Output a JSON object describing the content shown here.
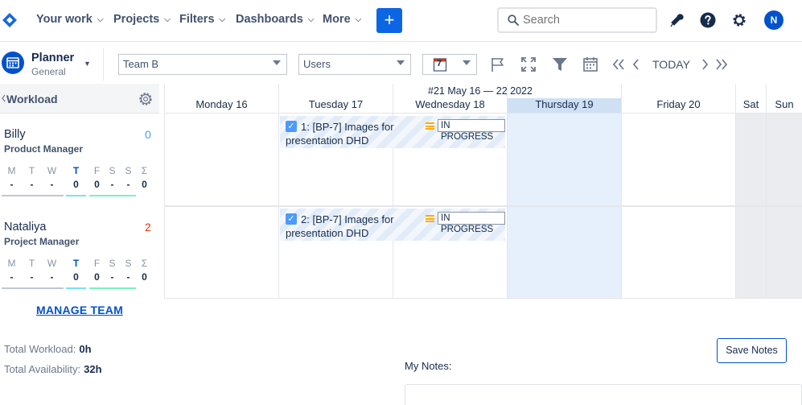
{
  "nav": {
    "items": [
      {
        "label": "Your work"
      },
      {
        "label": "Projects"
      },
      {
        "label": "Filters"
      },
      {
        "label": "Dashboards"
      },
      {
        "label": "More"
      }
    ],
    "create_label": "+",
    "search_placeholder": "Search",
    "avatar_initial": "N",
    "icons": [
      "notifications-icon",
      "help-icon",
      "settings-icon"
    ]
  },
  "toolbar": {
    "planner_title": "Planner",
    "planner_subtitle": "General",
    "team_select": "Team B",
    "view_select": "Users",
    "calendar_day": "7",
    "today_label": "TODAY"
  },
  "workload": {
    "title": "Workload",
    "day_letters": [
      "M",
      "T",
      "W",
      "T",
      "F",
      "S",
      "S",
      "Σ"
    ],
    "people": [
      {
        "name": "Billy",
        "role": "Product Manager",
        "count": "0",
        "count_color": "#4c9aff",
        "values": [
          "-",
          "-",
          "-",
          "0",
          "0",
          "-",
          "-",
          "0"
        ]
      },
      {
        "name": "Nataliya",
        "role": "Project Manager",
        "count": "2",
        "count_color": "#de350b",
        "values": [
          "-",
          "-",
          "-",
          "0",
          "0",
          "-",
          "-",
          "0"
        ]
      }
    ],
    "manage_team": "MANAGE TEAM"
  },
  "calendar": {
    "week_label": "#21 May 16 — 22 2022",
    "days": [
      "Monday 16",
      "Tuesday 17",
      "Wednesday 18",
      "Thursday 19",
      "Friday 20",
      "Sat",
      "Sun"
    ],
    "tasks": [
      {
        "check": "✓",
        "text": "1: [BP-7] Images for presentation DHD",
        "status": "IN PROGRESS"
      },
      {
        "check": "✓",
        "text": "2: [BP-7] Images for presentation DHD",
        "status": "IN PROGRESS"
      }
    ]
  },
  "footer": {
    "total_workload_label": "Total Workload:",
    "total_workload_value": "0h",
    "total_availability_label": "Total Availability:",
    "total_availability_value": "32h",
    "notes_label": "My Notes:",
    "save_notes": "Save Notes"
  }
}
